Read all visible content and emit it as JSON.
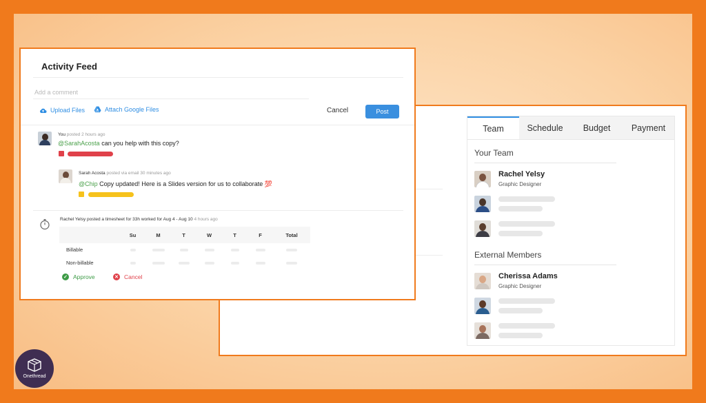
{
  "activity_feed": {
    "title": "Activity Feed",
    "comment_placeholder": "Add a comment",
    "upload_files": "Upload Files",
    "attach_google_files": "Attach Google Files",
    "cancel": "Cancel",
    "post": "Post",
    "entries": [
      {
        "author": "You",
        "action": "posted",
        "time": "2 hours ago",
        "mention": "@SarahAcosta",
        "text": "can you help with this copy?",
        "attachment_color": "#e0414a"
      },
      {
        "author": "Sarah Acosta",
        "action": "posted via email",
        "time": "30 minutes ago",
        "mention": "@Chip",
        "text": "Copy updated! Here is a Slides version for us to collaborate 💯",
        "attachment_color": "#f6c21c"
      }
    ],
    "timesheet": {
      "author": "Rachel Yelsy",
      "action": "posted a timesheet for 33h worked for Aug 4 - Aug 10",
      "time": "4 hours ago",
      "columns": [
        "Su",
        "M",
        "T",
        "W",
        "T",
        "F",
        "Total"
      ],
      "rows": [
        "Billable",
        "Non-billable"
      ],
      "approve": "Approve",
      "cancel": "Cancel"
    }
  },
  "team_card": {
    "tabs": [
      "Team",
      "Schedule",
      "Budget",
      "Payment"
    ],
    "active_tab": "Team",
    "your_team_title": "Your Team",
    "external_title": "External Members",
    "your_team": [
      {
        "name": "Rachel Yelsy",
        "role": "Graphic Designer"
      }
    ],
    "external": [
      {
        "name": "Cherissa Adams",
        "role": "Graphic Designer"
      }
    ]
  },
  "logo": {
    "text": "Onethread"
  },
  "colors": {
    "brand_orange": "#f07a1c",
    "accent_blue": "#2f8ee3",
    "approve_green": "#3e9b47",
    "cancel_red": "#e0414a"
  }
}
